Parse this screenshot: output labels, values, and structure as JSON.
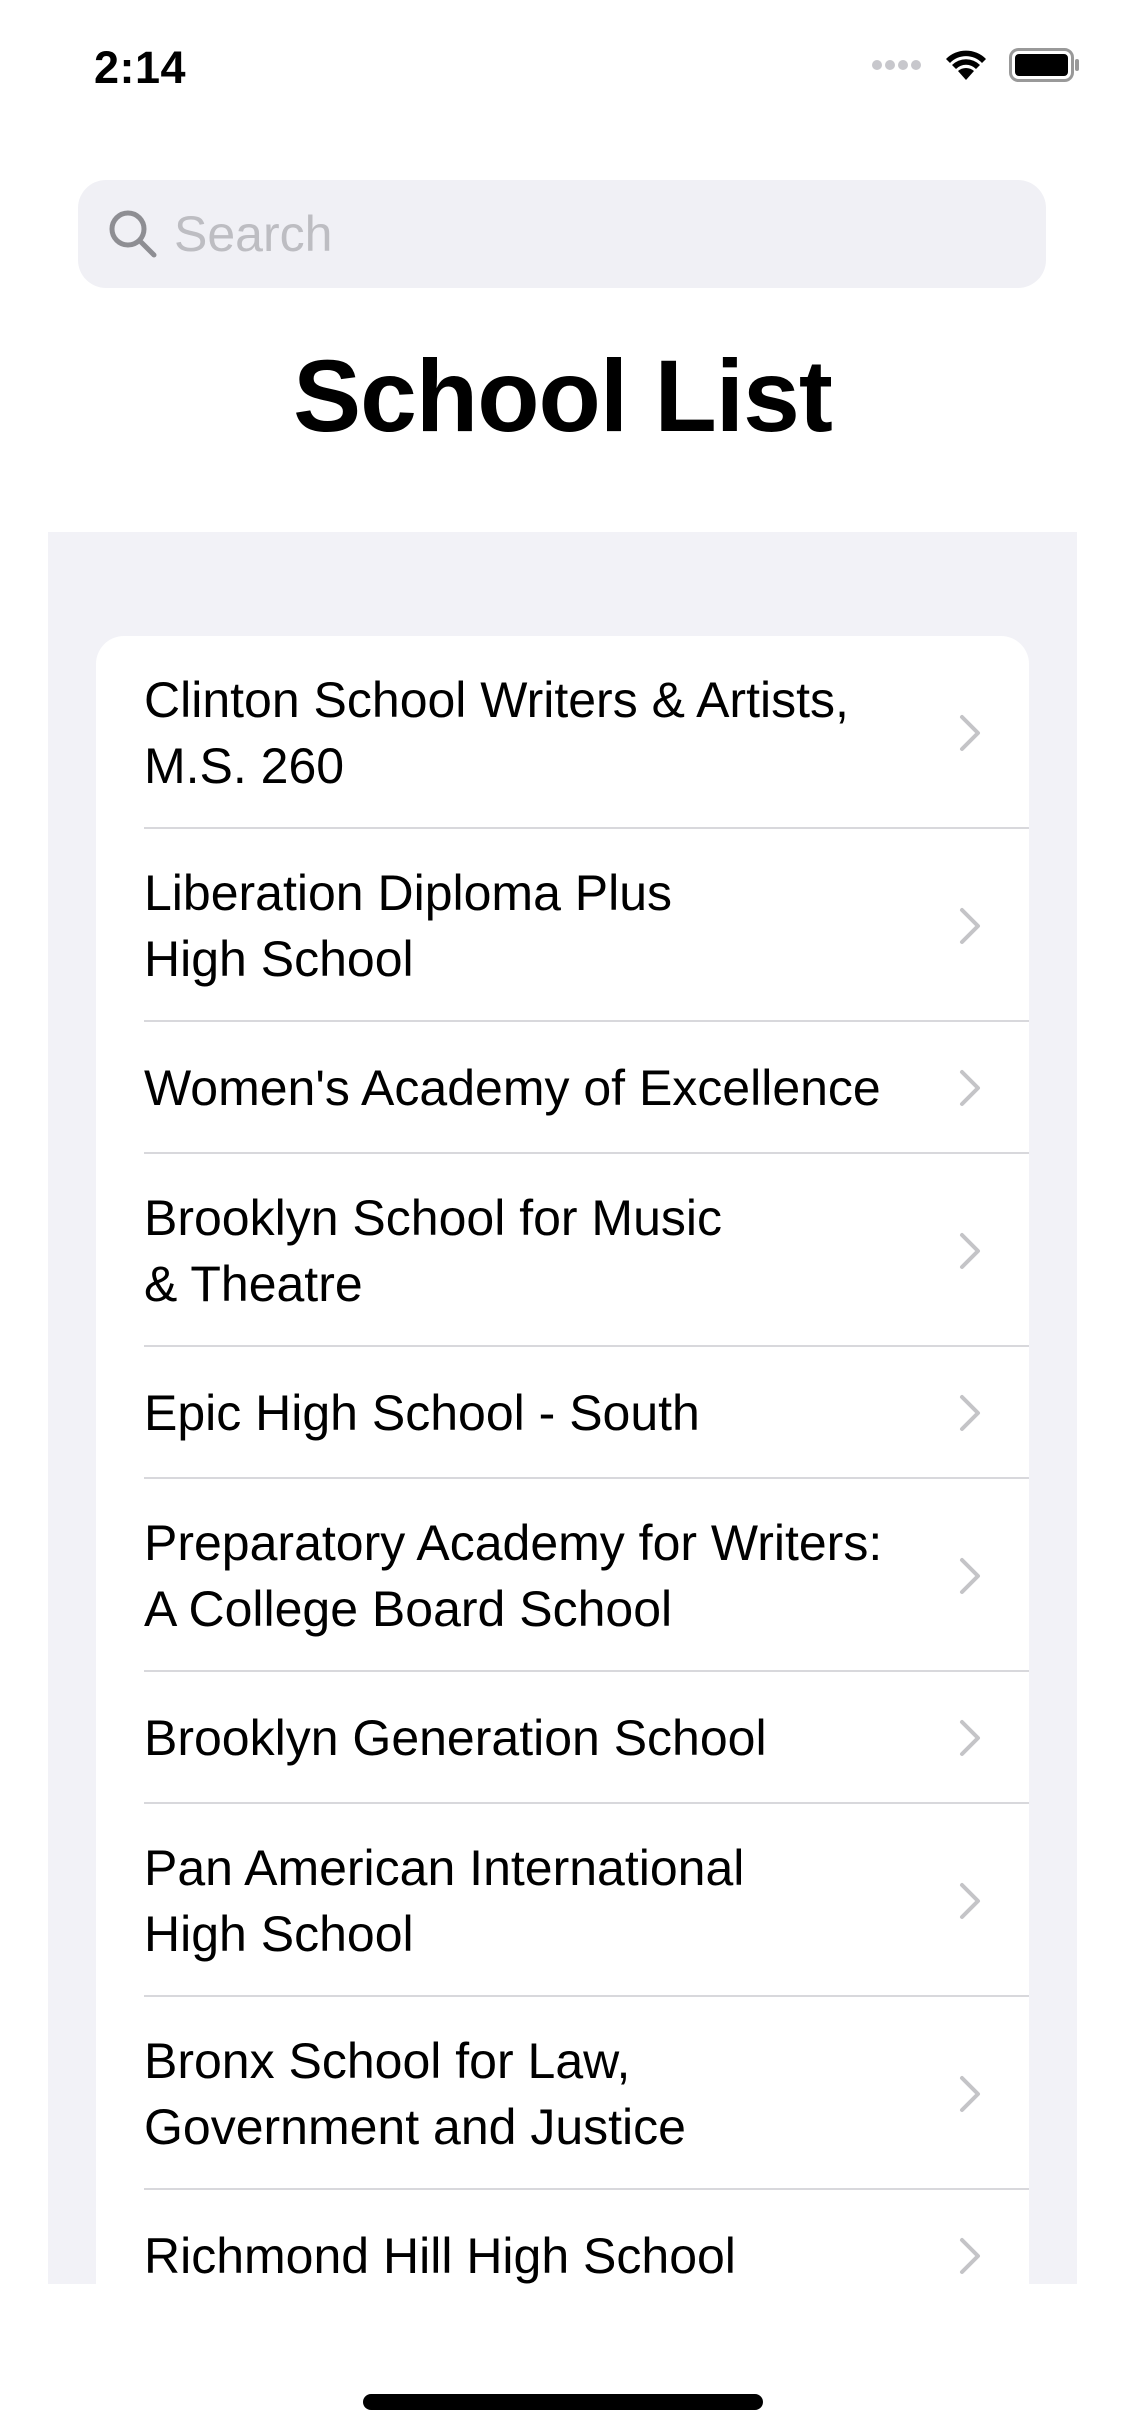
{
  "status_bar": {
    "time": "2:14",
    "icons": [
      "signal-dots-icon",
      "wifi-icon",
      "battery-icon"
    ]
  },
  "search": {
    "placeholder": "Search",
    "value": ""
  },
  "title": "School List",
  "schools": [
    "Clinton School Writers & Artists,\nM.S. 260",
    "Liberation Diploma Plus\nHigh School",
    "Women's Academy of Excellence",
    "Brooklyn School for Music\n& Theatre",
    "Epic High School - South",
    "Preparatory Academy for Writers:\nA College Board School",
    "Brooklyn Generation School",
    "Pan American International\nHigh School",
    "Bronx School for Law,\nGovernment and Justice",
    "Richmond Hill High School"
  ],
  "colors": {
    "background": "#ffffff",
    "list_background": "#f2f2f7",
    "search_background": "#f0f0f5",
    "placeholder": "#bdbdc2",
    "chevron": "#c4c4c7",
    "separator": "#d8d8dc"
  }
}
